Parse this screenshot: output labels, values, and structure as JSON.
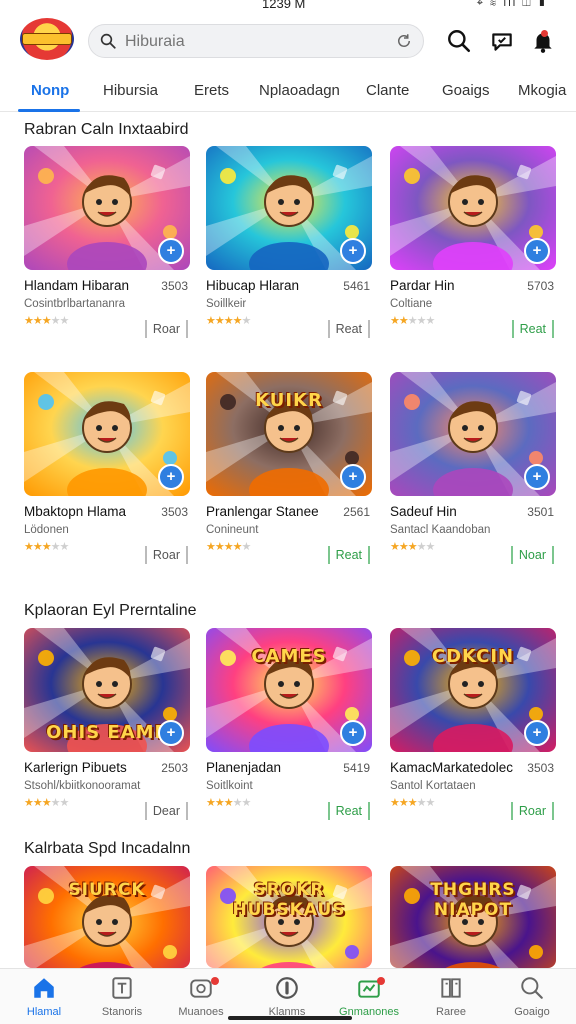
{
  "status": {
    "time": "1239 M",
    "icons": "⌖ ≋ ıll ◫ ▮"
  },
  "search": {
    "placeholder": "Hiburaia",
    "value": ""
  },
  "tabs": [
    "Nonp",
    "Hibursia",
    "Erets",
    "Nplaoadagn",
    "Clante",
    "Goaigs",
    "Mkogia"
  ],
  "sections": [
    {
      "title": "Rabran Caln Inxtaabird",
      "cards": [
        {
          "title": "Hlandam Hibaran",
          "size": "3503",
          "subtitle": "Cosintbrlbartananra",
          "rating": 3.5,
          "button": "Roar",
          "button_style": "grey",
          "theme": "pink"
        },
        {
          "title": "Hibucap Hlaran",
          "size": "5461",
          "subtitle": "Soillkeir",
          "rating": 4,
          "button": "Reat",
          "button_style": "grey",
          "theme": "teal"
        },
        {
          "title": "Pardar Hin",
          "size": "5703",
          "subtitle": "Coltiane",
          "rating": 2.5,
          "button": "Reat",
          "button_style": "green",
          "theme": "purple"
        }
      ]
    },
    {
      "title": "",
      "cards": [
        {
          "title": "Mbaktopn Hlama",
          "size": "3503",
          "subtitle": "Lödonen",
          "rating": 3.5,
          "button": "Roar",
          "button_style": "grey",
          "theme": "yellow"
        },
        {
          "title": "Pranlengar Stanee",
          "size": "2561",
          "subtitle": "Conineunt",
          "rating": 4,
          "button": "Reat",
          "button_style": "green",
          "theme": "arcade",
          "banner": "KUIKR"
        },
        {
          "title": "Sadeuf Hin",
          "size": "3501",
          "subtitle": "Santacl Kaandoban",
          "rating": 3.5,
          "button": "Noar",
          "button_style": "green",
          "theme": "violet"
        }
      ]
    },
    {
      "title": "Kplaoran Eyl Prerntaline",
      "cards": [
        {
          "title": "Karlerign Pibuets",
          "size": "2503",
          "subtitle": "Stsohl/kbiitkonooramat",
          "rating": 3.5,
          "button": "Dear",
          "button_style": "grey",
          "theme": "city",
          "banner": "OHIS EAME"
        },
        {
          "title": "Planenjadan",
          "size": "5419",
          "subtitle": "Soitlkoint",
          "rating": 3.5,
          "button": "Reat",
          "button_style": "green",
          "theme": "candy",
          "banner": "CAMES"
        },
        {
          "title": "KamacMarkatedolec",
          "size": "3503",
          "subtitle": "Santol Kortataen",
          "rating": 3.5,
          "button": "Roar",
          "button_style": "green",
          "theme": "crowd",
          "banner": "CDKCIN"
        }
      ]
    },
    {
      "title": "Kalrbata Spd Incadalnn",
      "cards": [
        {
          "title": "",
          "size": "",
          "subtitle": "",
          "rating": 0,
          "button": "",
          "button_style": "grey",
          "theme": "bear",
          "banner": "SIURCK"
        },
        {
          "title": "",
          "size": "",
          "subtitle": "",
          "rating": 0,
          "button": "",
          "button_style": "grey",
          "theme": "burst",
          "banner": "SROKR HUBSKAUS"
        },
        {
          "title": "",
          "size": "",
          "subtitle": "",
          "rating": 0,
          "button": "",
          "button_style": "grey",
          "theme": "heroes",
          "banner": "THGHRS NIAPOT"
        }
      ]
    }
  ],
  "bottom_nav": [
    {
      "label": "Hlamal",
      "icon": "home-icon",
      "active": true
    },
    {
      "label": "Stanoris",
      "icon": "document-icon"
    },
    {
      "label": "Muanoes",
      "icon": "gamepad-icon",
      "badge": true
    },
    {
      "label": "Klanms",
      "icon": "circle-icon"
    },
    {
      "label": "Gnmanones",
      "icon": "store-icon",
      "badge": true
    },
    {
      "label": "Raree",
      "icon": "book-icon"
    },
    {
      "label": "Goaigo",
      "icon": "search-icon"
    }
  ],
  "colors": {
    "accent": "#1a73e8",
    "green": "#2e9e48",
    "badge": "#e53935"
  }
}
